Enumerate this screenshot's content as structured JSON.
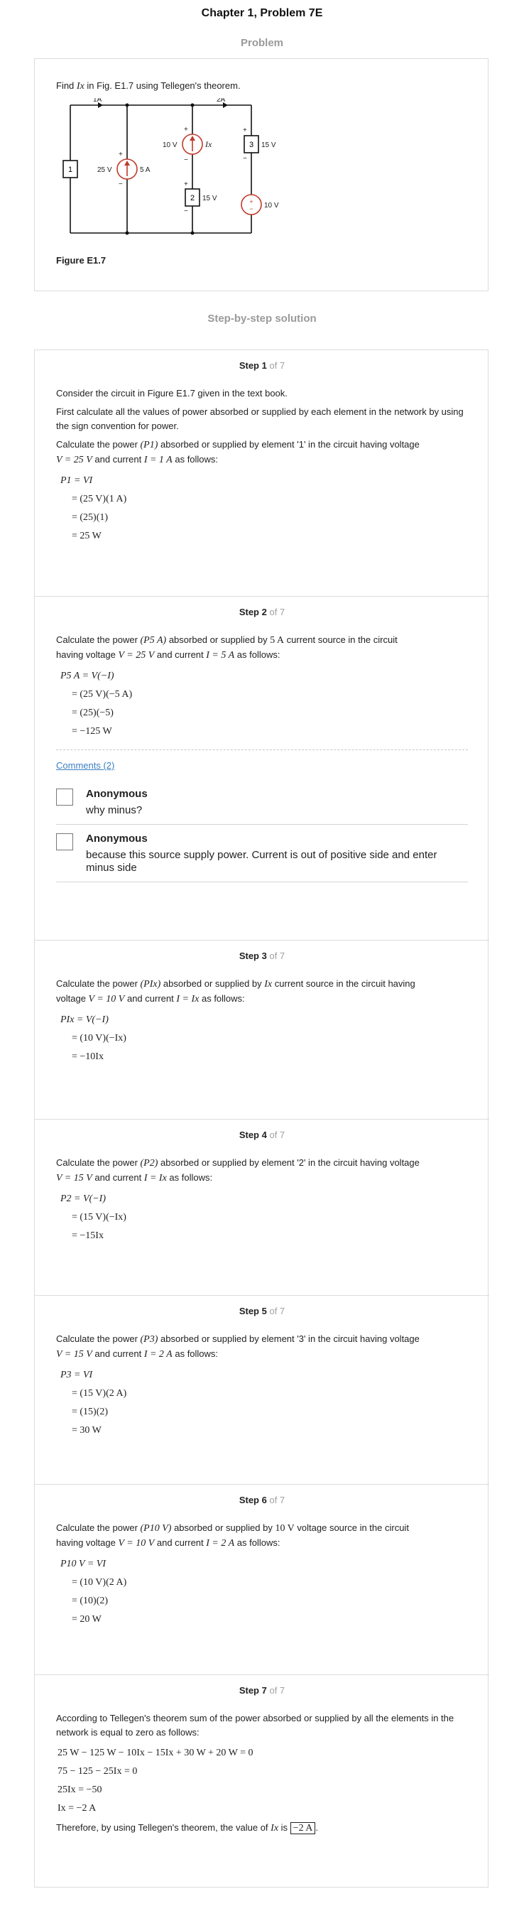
{
  "title": "Chapter 1, Problem 7E",
  "problem_label": "Problem",
  "problem_text_prefix": "Find ",
  "problem_text_var": "Ix",
  "problem_text_suffix": " in Fig. E1.7 using Tellegen's theorem.",
  "figure": {
    "caption": "Figure E1.7",
    "labels": {
      "i1": "1A",
      "i2": "2A",
      "e1": "1",
      "v25": "25 V",
      "i5": "5 A",
      "v10a": "10 V",
      "ix": "Ix",
      "e2": "2",
      "v15a": "15 V",
      "e3": "3",
      "v15b": "15 V",
      "v10b": "10 V",
      "plus": "+",
      "minus": "−"
    }
  },
  "solution_label": "Step-by-step solution",
  "steps": [
    {
      "num": "Step 1",
      "of": "of 7",
      "p1": "Consider the circuit in Figure E1.7 given in the text book.",
      "p2": "First calculate all the values of power absorbed or supplied by each element in the network by using the sign convention for power.",
      "p3a": "Calculate the power ",
      "p3sym": "(P1)",
      "p3b": " absorbed or supplied by element '1' in the circuit having voltage",
      "p4a": "V = 25 V",
      "p4b": " and current ",
      "p4c": "I = 1 A",
      "p4d": " as follows:",
      "eq": [
        "P1 = VI",
        "= (25 V)(1 A)",
        "= (25)(1)",
        "= 25 W"
      ]
    },
    {
      "num": "Step 2",
      "of": "of 7",
      "p3a": "Calculate the power ",
      "p3sym": "(P5 A)",
      "p3b": " absorbed or supplied by ",
      "p3c": "5 A",
      "p3d": " current source in the circuit",
      "p4a": "having voltage ",
      "p4b": "V = 25 V",
      "p4c": " and current ",
      "p4d": "I = 5 A",
      "p4e": " as follows:",
      "eq": [
        "P5 A = V(−I)",
        "= (25 V)(−5 A)",
        "= (25)(−5)",
        "= −125 W"
      ],
      "comments_link": "Comments (2)",
      "comments": [
        {
          "author": "Anonymous",
          "text": "why minus?"
        },
        {
          "author": "Anonymous",
          "text": "because this source supply power. Current is out of positive side and enter minus side"
        }
      ]
    },
    {
      "num": "Step 3",
      "of": "of 7",
      "p3a": "Calculate the power ",
      "p3sym": "(PIx)",
      "p3b": " absorbed or supplied by ",
      "p3c": "Ix",
      "p3d": " current source in the circuit having",
      "p4a": "voltage ",
      "p4b": "V = 10 V",
      "p4c": " and current ",
      "p4d": "I = Ix",
      "p4e": " as follows:",
      "eq": [
        "PIx = V(−I)",
        "= (10 V)(−Ix)",
        "= −10Ix"
      ]
    },
    {
      "num": "Step 4",
      "of": "of 7",
      "p3a": "Calculate the power ",
      "p3sym": "(P2)",
      "p3b": " absorbed or supplied by element '2' in the circuit having voltage",
      "p4a": "V = 15 V",
      "p4b": " and current ",
      "p4c": "I = Ix",
      "p4d": " as follows:",
      "eq": [
        "P2 = V(−I)",
        "= (15 V)(−Ix)",
        "= −15Ix"
      ]
    },
    {
      "num": "Step 5",
      "of": "of 7",
      "p3a": "Calculate the power ",
      "p3sym": "(P3)",
      "p3b": " absorbed or supplied by element '3' in the circuit having voltage",
      "p4a": "V = 15 V",
      "p4b": " and current ",
      "p4c": "I = 2 A",
      "p4d": " as follows:",
      "eq": [
        "P3 = VI",
        "= (15 V)(2 A)",
        "= (15)(2)",
        "= 30 W"
      ]
    },
    {
      "num": "Step 6",
      "of": "of 7",
      "p3a": "Calculate the power ",
      "p3sym": "(P10 V)",
      "p3b": " absorbed or supplied by ",
      "p3c": "10 V",
      "p3d": " voltage source in the circuit",
      "p4a": "having voltage ",
      "p4b": "V = 10 V",
      "p4c": " and current ",
      "p4d": "I = 2 A",
      "p4e": " as follows:",
      "eq": [
        "P10 V = VI",
        "= (10 V)(2 A)",
        "= (10)(2)",
        "= 20 W"
      ]
    },
    {
      "num": "Step 7",
      "of": "of 7",
      "p1": "According to Tellegen's theorem sum of the power absorbed or supplied by all the elements in the network is equal to zero as follows:",
      "eq": [
        "25 W − 125 W − 10Ix − 15Ix + 30 W + 20 W = 0",
        "75 − 125 − 25Ix = 0",
        "25Ix = −50",
        "Ix = −2 A"
      ],
      "final_a": "Therefore, by using Tellegen's theorem, the value of ",
      "final_var": "Ix",
      "final_b": " is ",
      "final_ans": "−2 A",
      "final_c": "."
    }
  ]
}
